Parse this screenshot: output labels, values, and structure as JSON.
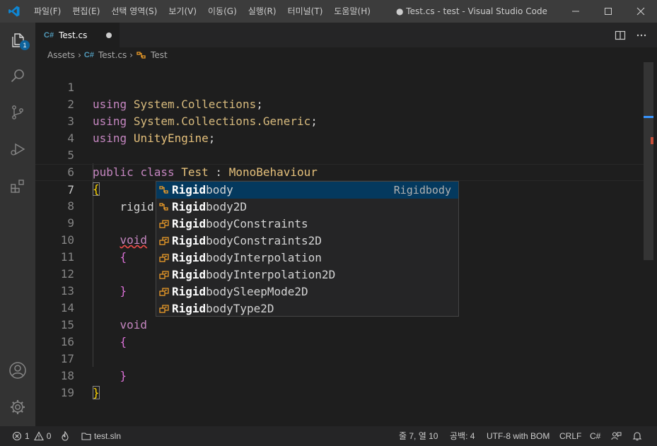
{
  "window": {
    "title": "● Test.cs - test - Visual Studio Code"
  },
  "menu": [
    "파일(F)",
    "편집(E)",
    "선택 영역(S)",
    "보기(V)",
    "이동(G)",
    "실행(R)",
    "터미널(T)",
    "도움말(H)"
  ],
  "activity": {
    "explorer_badge": "1"
  },
  "tab": {
    "lang": "C#",
    "name": "Test.cs"
  },
  "breadcrumb": {
    "folder": "Assets",
    "lang": "C#",
    "file": "Test.cs",
    "symbol": "Test"
  },
  "editor": {
    "line_numbers": [
      "1",
      "2",
      "3",
      "4",
      "5",
      "6",
      "7",
      "8",
      "9",
      "10",
      "11",
      "12",
      "13",
      "14",
      "15",
      "16",
      "17",
      "18",
      "19"
    ],
    "l1_kw": "using",
    "l1_ns": "System.Collections",
    "l1_end": ";",
    "l2_kw": "using",
    "l2_ns": "System.Collections.Generic",
    "l2_end": ";",
    "l3_kw": "using",
    "l3_ns": "UnityEngine",
    "l3_end": ";",
    "l5_kw1": "public",
    "l5_kw2": "class",
    "l5_name": "Test",
    "l5_colon": " : ",
    "l5_base": "MonoBehaviour",
    "l6": "{",
    "l7": "rigid",
    "l9": "void",
    "l10": "{",
    "l12": "}",
    "l14": "void",
    "l15": "{",
    "l17": "}",
    "l18": "}"
  },
  "suggestions": [
    {
      "match": "Rigid",
      "rest": "body",
      "detail": "Rigidbody",
      "kind": "class"
    },
    {
      "match": "Rigid",
      "rest": "body2D",
      "detail": "",
      "kind": "class"
    },
    {
      "match": "Rigid",
      "rest": "bodyConstraints",
      "detail": "",
      "kind": "enum"
    },
    {
      "match": "Rigid",
      "rest": "bodyConstraints2D",
      "detail": "",
      "kind": "enum"
    },
    {
      "match": "Rigid",
      "rest": "bodyInterpolation",
      "detail": "",
      "kind": "enum"
    },
    {
      "match": "Rigid",
      "rest": "bodyInterpolation2D",
      "detail": "",
      "kind": "enum"
    },
    {
      "match": "Rigid",
      "rest": "bodySleepMode2D",
      "detail": "",
      "kind": "enum"
    },
    {
      "match": "Rigid",
      "rest": "bodyType2D",
      "detail": "",
      "kind": "enum"
    }
  ],
  "status": {
    "errors": "1",
    "warnings": "0",
    "solution": "test.sln",
    "position": "줄 7, 열 10",
    "indent": "공백: 4",
    "encoding": "UTF-8 with BOM",
    "eol": "CRLF",
    "language": "C#"
  },
  "colors": {
    "accent": "#0e639c",
    "keyword": "#c586c0",
    "namespace": "#d7ba7d",
    "type": "#e5c07b"
  }
}
